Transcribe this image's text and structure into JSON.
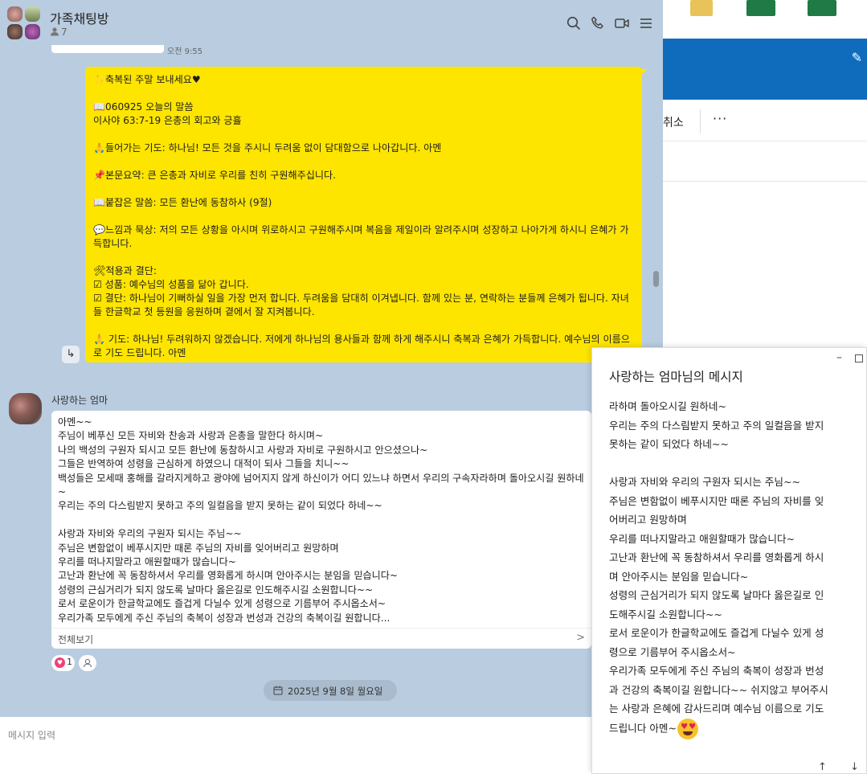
{
  "chat": {
    "title": "가족채팅방",
    "member_count": "7",
    "prev_time": "오전 9:55",
    "my_message": {
      "lines": [
        "✨축복된 주말 보내세요♥",
        "",
        "📖060925 오늘의 말씀",
        "이사야 63:7-19 은총의 회고와 긍휼",
        "",
        "🙏들어가는 기도: 하나님! 모든 것을 주시니 두려움 없이 담대함으로 나아갑니다. 아멘",
        "",
        "📌본문요약: 큰 은총과 자비로 우리를 친히 구원해주십니다.",
        "",
        "📖붙잡은 말씀: 모든 환난에 동참하사 (9절)",
        "",
        "💬느낌과 묵상: 저의 모든 상황을 아시며 위로하시고 구원해주시며 복음을 제일이라 알려주시며 성장하고 나아가게 하시니 은혜가 가득합니다.",
        "",
        "🛠적용과 결단:",
        "☑ 성품: 예수님의 성품을 닮아 갑니다.",
        "☑ 결단: 하나님이 기뻐하실 일을 가장 먼저 합니다. 두려움을 담대히 이겨냅니다. 함께 있는 분, 연락하는 분들께 은혜가 됩니다. 자녀들 한글학교 첫 등원을 응원하며 곁에서 잘 지켜봅니다.",
        "",
        "🙏 기도: 하나님! 두려워하지 않겠습니다. 저에게 하나님의 용사들과 함께 하게 해주시니 축복과 은혜가 가득합니다. 예수님의 이름으로 기도 드립니다. 아멘"
      ]
    },
    "sender": "사랑하는 엄마",
    "their_message": {
      "lines": [
        "아멘~~",
        "주님이 베푸신 모든 자비와 찬송과 사랑과 은총을 말한다 하시며~",
        "나의 백성의 구원자 되시고 모든 환난에 동참하시고 사랑과 자비로 구원하시고 안으셨으나~",
        "그들은 반역하여 성령을 근심하게 하였으니 대적이 되사 그들을 치니~~",
        "백성들은 모세때 홍해를 갈라지게하고 광야에 넘어지지 않게 하신이가 어디 있느냐 하면서 우리의 구속자라하며 돌아오시길 원하네~",
        "우리는 주의 다스림받지 못하고 주의 일컬음을 받지 못하는 같이 되었다 하네~~",
        "",
        "사랑과 자비와 우리의 구원자 되시는 주님~~",
        "주님은 변함없이 베푸시지만 때론 주님의 자비를 잊어버리고 원망하며",
        "우리를 떠나지말라고 애원할때가 많습니다~",
        "고난과 환난에 꼭 동참하셔서 우리를 영화롭게 하시며 안아주시는 분임을 믿습니다~",
        "성령의 근심거리가 되지 않도록 날마다 옳은길로 인도해주시길 소원합니다~~",
        "로서 로운이가 한글학교에도 즐겁게 다닐수 있게 성령으로 기름부어 주시옵소서~",
        "우리가족 모두에게 주신 주님의 축복이 성장과 번성과 건강의 축복이길 원합니다..."
      ],
      "see_all": "전체보기",
      "see_all_chevron": ">"
    },
    "reaction_count": "1",
    "date_divider": "2025년 9월 8일 월요일",
    "input_placeholder": "메시지 입력"
  },
  "popup": {
    "title": "사랑하는 엄마님의 메시지",
    "lines": [
      "라하며 돌아오시길 원하네~",
      "우리는 주의 다스림받지 못하고 주의 일컬음을 받지",
      "못하는 같이 되었다 하네~~",
      "",
      "사랑과 자비와 우리의 구원자 되시는 주님~~",
      "주님은 변함없이 베푸시지만 때론 주님의 자비를 잊",
      "어버리고 원망하며",
      "우리를 떠나지말라고 애원할때가 많습니다~",
      "고난과 환난에 꼭 동참하셔서 우리를 영화롭게 하시",
      "며 안아주시는 분임을 믿습니다~",
      "성령의 근심거리가 되지 않도록 날마다 옳은길로 인",
      "도해주시길 소원합니다~~",
      "로서 로운이가 한글학교에도 즐겁게 다닐수 있게 성",
      "령으로 기름부어 주시옵소서~",
      "우리가족 모두에게 주신 주님의 축복이 성장과 번성",
      "과 건강의 축복이길 원합니다~~ 쉬지않고 부어주시",
      "는 사랑과 은혜에 감사드리며 예수님 이름으로 기도"
    ],
    "last_line": "드립니다 아멘~",
    "emoji": "smiling-face-with-heart-eyes"
  },
  "bg_app": {
    "cancel_label": "취소",
    "more_label": "···"
  },
  "icons": [
    "search-icon",
    "phone-icon",
    "video-call-icon",
    "menu-icon",
    "member-icon",
    "share-icon",
    "calendar-icon",
    "heart-icon",
    "user-icon",
    "minimize-icon",
    "maximize-icon",
    "scroll-up-icon",
    "scroll-down-icon",
    "edit-icon"
  ],
  "colors": {
    "chat_bg": "#b9cce0",
    "my_bubble": "#fee500",
    "their_bubble": "#ffffff",
    "ribbon": "#0f6cbd",
    "heart": "#f0407a"
  }
}
